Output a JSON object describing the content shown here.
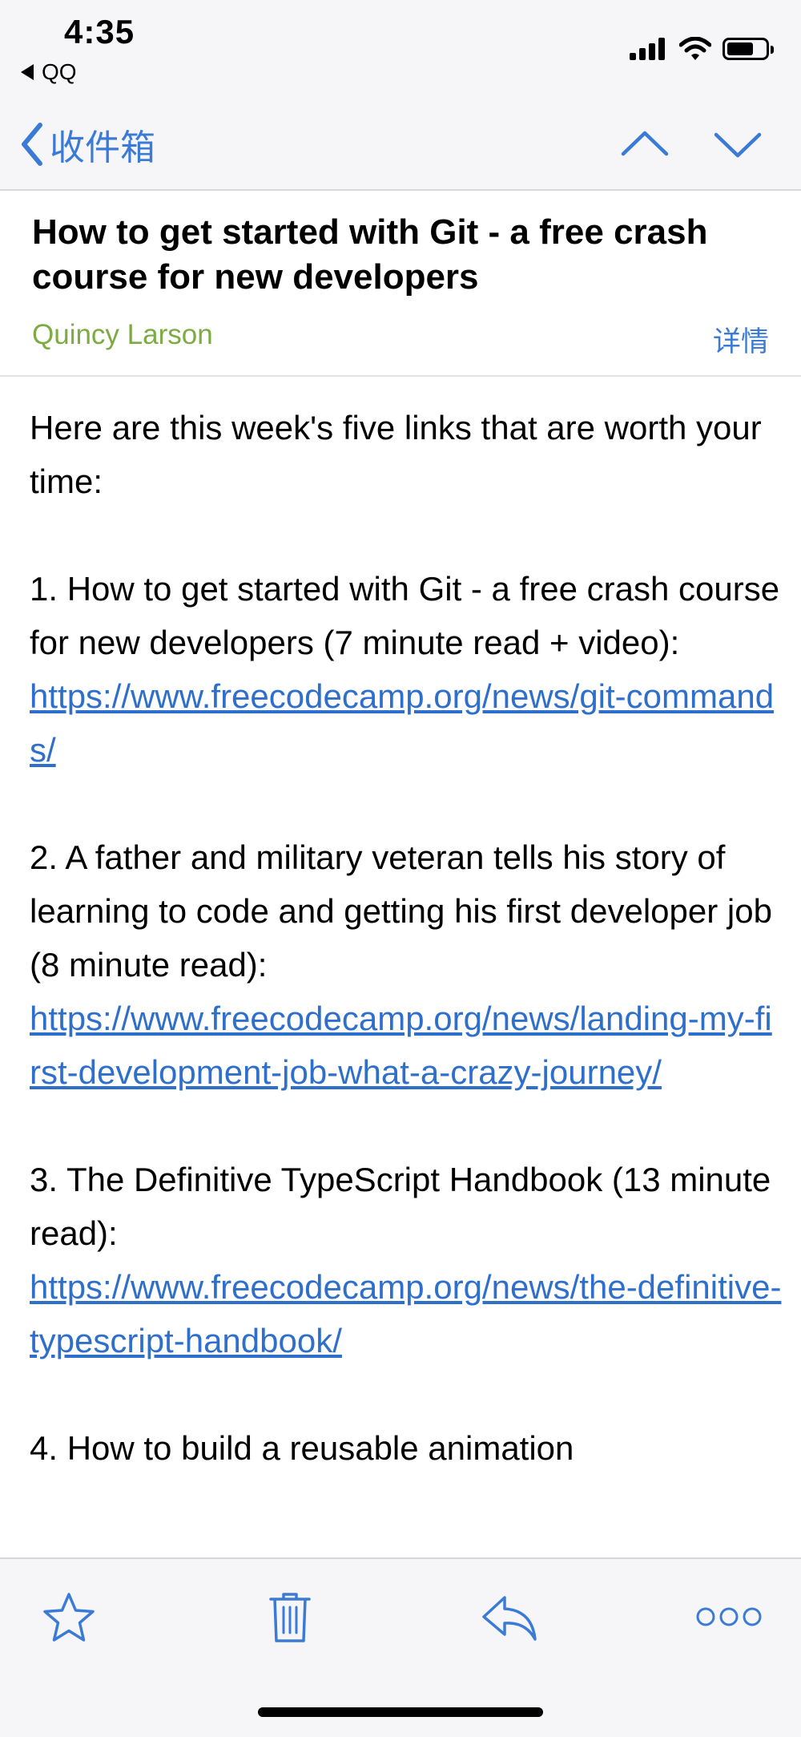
{
  "status_bar": {
    "time": "4:35",
    "back_app": "QQ",
    "icons": [
      "signal-icon",
      "wifi-icon",
      "battery-icon"
    ]
  },
  "nav": {
    "back_label": "收件箱",
    "up_icon": "chevron-up-icon",
    "down_icon": "chevron-down-icon",
    "accent_color": "#3b7bd6"
  },
  "email": {
    "subject": "How to get started with Git - a free crash course for new developers",
    "sender": "Quincy Larson",
    "sender_color": "#7cab42",
    "details_label": "详情",
    "intro": "Here are this week's five links that are worth your time:",
    "items": [
      {
        "text": "1. How to get started with Git - a free crash course for new developers (7 minute read + video):",
        "link": "https://www.freecodecamp.org/news/git-commands/"
      },
      {
        "text": "2. A father and military veteran tells his story of learning to code and getting his first developer job (8 minute read):",
        "link": "https://www.freecodecamp.org/news/landing-my-first-development-job-what-a-crazy-journey/"
      },
      {
        "text": "3. The Definitive TypeScript Handbook (13 minute read):",
        "link": "https://www.freecodecamp.org/news/the-definitive-typescript-handbook/"
      },
      {
        "text": "4. How to build a reusable animation"
      }
    ]
  },
  "toolbar": {
    "icons": [
      "star-icon",
      "trash-icon",
      "reply-icon",
      "more-icon"
    ]
  }
}
